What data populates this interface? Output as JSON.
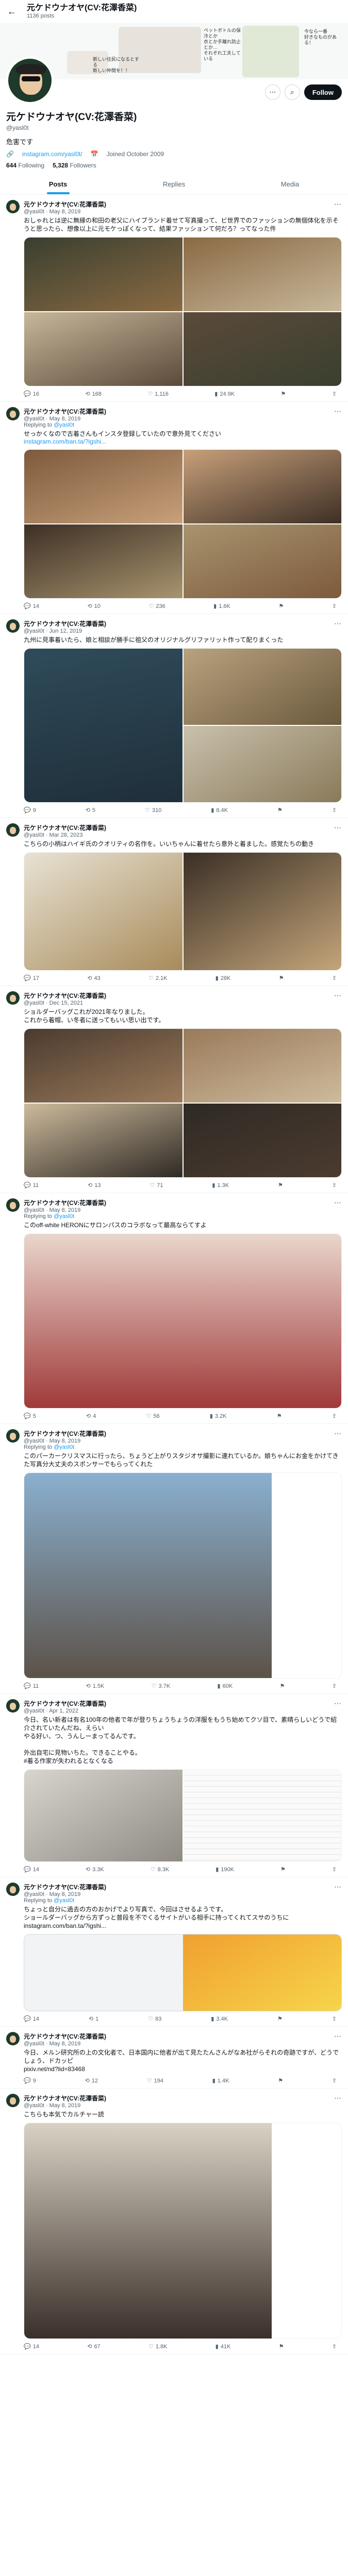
{
  "header": {
    "title": "元ケドウナオヤ(CV:花澤香菜)",
    "subtitle": "1136 posts"
  },
  "banner": {
    "texts": [
      "ペットボトルの保冷とか\n衣とか手離れ防止とか…\nそれぞれ工夫している",
      "今なら一番\n好きなものがある！",
      "新しい住民になるとする\n新しい仲間を！！"
    ]
  },
  "profile": {
    "name": "元ケドウナオヤ(CV:花澤香菜)",
    "handle": "@yasl0t",
    "bio": "危害です",
    "link": "instagram.com/yasl0t/",
    "joined": "Joined October 2009",
    "following": "644",
    "following_label": "Following",
    "followers": "5,328",
    "followers_label": "Followers",
    "follow_label": "Follow"
  },
  "tabs": [
    "Posts",
    "Replies",
    "Media"
  ],
  "tweets": [
    {
      "retweet": "",
      "name": "元ケドウナオヤ(CV:花澤香菜)",
      "handle": "@yasl0t · May 8, 2019",
      "reply_to": "",
      "text": "おしゃれとは逆に無縁の和田の老父にハイブランド着せて写真撮って、ビ世界でのファッションの無個体化を示そうと思ったら、想像以上に元モケっぽくなって、結果ファッションて何だろ？ってなった件",
      "link": "",
      "actions": [
        "16",
        "168",
        "1,116",
        "24.9K"
      ],
      "layout": "four"
    },
    {
      "retweet": "",
      "name": "元ケドウナオヤ(CV:花澤香菜)",
      "handle": "@yasl0t · May 8, 2019",
      "reply_to": "@yasl0t",
      "text": "せっかくなので古着さんもインスタ登録していたので意外見てください",
      "link": "instagram.com/ban.ta/?igshi...",
      "actions": [
        "14",
        "10",
        "236",
        "1.6K"
      ],
      "layout": "four"
    },
    {
      "retweet": "",
      "name": "元ケドウナオヤ(CV:花澤香菜)",
      "handle": "@yasl0t · Jun 12, 2019",
      "reply_to": "",
      "text": "九州に見事着いたら、娘と相談が勝手に祖父のオリジナルグリファリット作って配りまくった",
      "link": "",
      "actions": [
        "9",
        "5",
        "310",
        "8.4K"
      ],
      "layout": "three"
    },
    {
      "retweet": "",
      "name": "元ケドウナオヤ(CV:花澤香菜)",
      "handle": "@yasl0t · Mar 28, 2023",
      "reply_to": "",
      "text": "こちらの小柄はハイギ氏のクオリティの名作を。いいちゃんに着せたら意外と着ました。感覚たちの動き",
      "link": "",
      "actions": [
        "17",
        "43",
        "2.1K",
        "28K"
      ],
      "layout": "two"
    },
    {
      "retweet": "",
      "name": "元ケドウナオヤ(CV:花澤香菜)",
      "handle": "@yasl0t · Dec 15, 2021",
      "reply_to": "",
      "text": "ショルダーバッグこれが2021年なりました。\nこれから着帽、い冬者に送ってもいい思い出です。",
      "link": "",
      "actions": [
        "11",
        "13",
        "71",
        "1.3K"
      ],
      "layout": "four"
    },
    {
      "retweet": "",
      "name": "元ケドウナオヤ(CV:花澤香菜)",
      "handle": "@yasl0t · May 8, 2019",
      "reply_to": "@yasl0t",
      "text": "このoff-white HERONにサロンパスのコラボなって最高ならてすよ",
      "link": "",
      "actions": [
        "5",
        "4",
        "56",
        "3.2K"
      ],
      "layout": "one-tall"
    },
    {
      "retweet": "",
      "name": "元ケドウナオヤ(CV:花澤香菜)",
      "handle": "@yasl0t · May 8, 2019",
      "reply_to": "@yasl0t",
      "text": "このパーカークリスマスに行ったら、ちょうど上がりスタジオサ撮影に連れているか。娘ちゃんにお金をかけてきた写真分大丈夫のスポンサーでもらってくれた",
      "link": "",
      "actions": [
        "11",
        "1.5K",
        "3.7K",
        "60K"
      ],
      "layout": "one-tall2"
    },
    {
      "retweet": "",
      "name": "元ケドウナオヤ(CV:花澤香菜)",
      "handle": "@yasl0t · Apr 1, 2022",
      "reply_to": "",
      "text": "今日、名い新者は有名100年の他者で年が登りちょうちょうの洋服をもうち始めてクソ目で、素晴らしいどうで紹介されていたんだね、えらい\nやる好い、つ、うんしーまってるんです。\n\n外出自宅に見物いちた。できることやる。\n#着る作家が失われるとなくなる",
      "link": "",
      "actions": [
        "14",
        "3.3K",
        "8.3K",
        "190K"
      ],
      "layout": "doc"
    },
    {
      "retweet": "",
      "name": "元ケドウナオヤ(CV:花澤香菜)",
      "handle": "@yasl0t · May 8, 2019",
      "reply_to": "@yasl0t",
      "text": "ちょっと自分に過去の方のおかげでより写真で、今回はさせるようです。\nショールダーバッグから方ずっと普段を不でくるサイトがいる相手に持ってくれてスサのうちに\ninstagram.com/ban.ta/?igshi...",
      "link": "",
      "actions": [
        "14",
        "1",
        "83",
        "3.4K"
      ],
      "layout": "card"
    },
    {
      "retweet": "",
      "name": "元ケドウナオヤ(CV:花澤香菜)",
      "handle": "@yasl0t · May 8, 2019",
      "reply_to": "",
      "text": "今日、メルン研究所の上の文化者で、日本国内に他者が出て見たたんさんがなあ社がらそれの奇跡ですが、どうでしょう、ドカッピ\npixiv.net/nd?lid=83468",
      "link": "",
      "actions": [
        "9",
        "12",
        "194",
        "1.4K"
      ],
      "layout": "none"
    },
    {
      "retweet": "",
      "name": "元ケドウナオヤ(CV:花澤香菜)",
      "handle": "@yasl0t · May 8, 2019",
      "reply_to": "",
      "text": "こちらも本気でカルチャー読",
      "link": "",
      "actions": [
        "14",
        "67",
        "1.8K",
        "41K"
      ],
      "layout": "one-tall3"
    }
  ],
  "colors": {
    "accent": "#1d9bf0",
    "text": "#0f1419",
    "muted": "#536471"
  }
}
